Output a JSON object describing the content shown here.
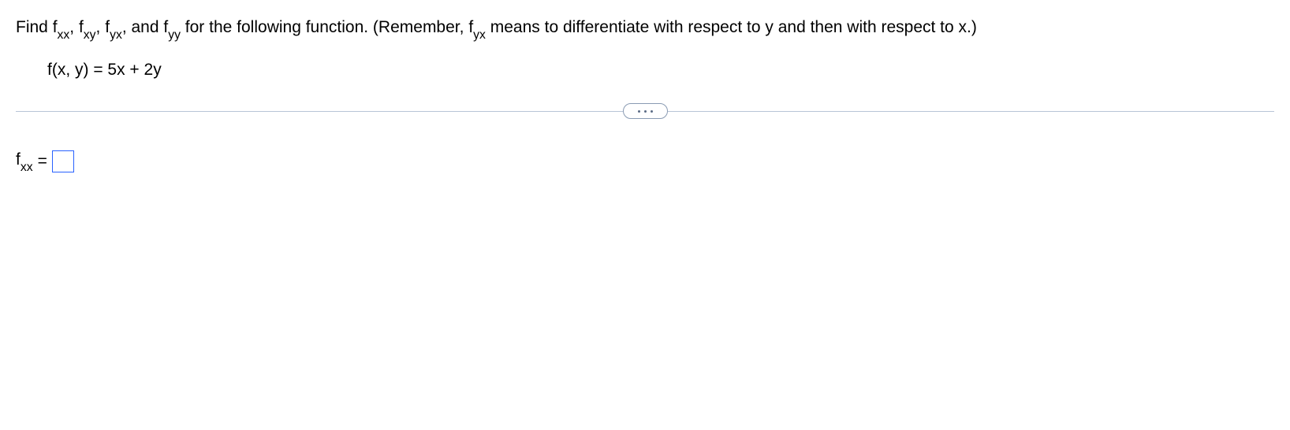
{
  "question": {
    "lead": "Find ",
    "terms": {
      "t1_base": "f",
      "t1_sub": "xx",
      "sep1": ", ",
      "t2_base": "f",
      "t2_sub": "xy",
      "sep2": ", ",
      "t3_base": "f",
      "t3_sub": "yx",
      "sep3": ", and ",
      "t4_base": "f",
      "t4_sub": "yy"
    },
    "mid": " for the following function. (Remember, ",
    "remember_base": "f",
    "remember_sub": "yx",
    "tail": " means to differentiate with respect to y and then with respect to x.)"
  },
  "function_def": "f(x, y) = 5x + 2y",
  "answer": {
    "label_base": "f",
    "label_sub": "xx",
    "equals": " = ",
    "value": ""
  }
}
